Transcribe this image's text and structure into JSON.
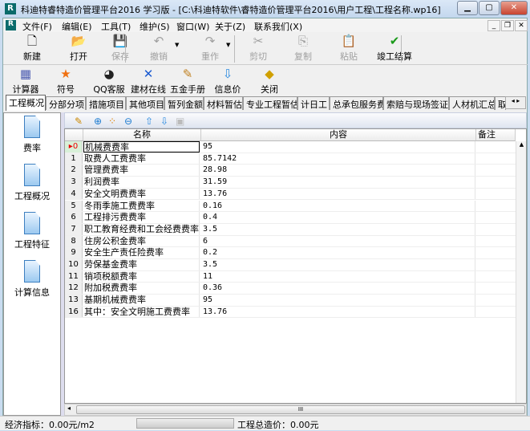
{
  "window": {
    "title": "科迪特睿特造价管理平台2016 学习版 - [C:\\科迪特软件\\睿特造价管理平台2016\\用户工程\\工程名称.wp16]",
    "logo": "R"
  },
  "menu": [
    "文件(F)",
    "编辑(E)",
    "工具(T)",
    "维护(S)",
    "窗口(W)",
    "关于(Z)",
    "联系我们(X)"
  ],
  "toolbar1": [
    {
      "label": "新建",
      "icon": "new-file-icon",
      "glyph": "🗋",
      "enabled": true
    },
    {
      "label": "打开",
      "icon": "open-folder-icon",
      "glyph": "📂",
      "enabled": true
    },
    {
      "label": "保存",
      "icon": "save-icon",
      "glyph": "💾",
      "enabled": false
    },
    {
      "label": "撤销",
      "icon": "undo-icon",
      "glyph": "↶",
      "enabled": false
    },
    {
      "label": "重作",
      "icon": "redo-icon",
      "glyph": "↷",
      "enabled": false
    },
    {
      "label": "剪切",
      "icon": "cut-icon",
      "glyph": "✂",
      "enabled": false
    },
    {
      "label": "复制",
      "icon": "copy-icon",
      "glyph": "⎘",
      "enabled": false
    },
    {
      "label": "粘贴",
      "icon": "paste-icon",
      "glyph": "📋",
      "enabled": false
    },
    {
      "label": "竣工结算",
      "icon": "checkmark-icon",
      "glyph": "✔",
      "enabled": true
    }
  ],
  "toolbar2": [
    {
      "label": "计算器",
      "icon": "calculator-icon",
      "glyph": "▦"
    },
    {
      "label": "符号",
      "icon": "star-icon",
      "glyph": "★"
    },
    {
      "label": "QQ客服",
      "icon": "qq-penguin-icon",
      "glyph": "◕"
    },
    {
      "label": "建材在线",
      "icon": "building-material-icon",
      "glyph": "✕"
    },
    {
      "label": "五金手册",
      "icon": "handbook-icon",
      "glyph": "✎"
    },
    {
      "label": "信息价",
      "icon": "down-arrow-icon",
      "glyph": "⇩"
    },
    {
      "label": "关闭",
      "icon": "close-sign-icon",
      "glyph": "◆"
    }
  ],
  "tabs": [
    "工程概况",
    "分部分项",
    "措施项目",
    "其他项目",
    "暂列金额",
    "材料暂估",
    "专业工程暂估",
    "计日工",
    "总承包服务费",
    "索赔与现场签证",
    "人材机汇总",
    "取费"
  ],
  "active_tab": "工程概况",
  "left_nav": [
    "费率",
    "工程概况",
    "工程特征",
    "计算信息"
  ],
  "grid": {
    "headers": [
      "名称",
      "内容",
      "备注"
    ],
    "rows": [
      {
        "no": "0",
        "name": "机械费费率",
        "value": "95"
      },
      {
        "no": "1",
        "name": "取费人工费费率",
        "value": "85.7142"
      },
      {
        "no": "2",
        "name": "管理费费率",
        "value": "28.98"
      },
      {
        "no": "3",
        "name": "利润费率",
        "value": "31.59"
      },
      {
        "no": "4",
        "name": "安全文明费费率",
        "value": "13.76"
      },
      {
        "no": "5",
        "name": "冬雨季施工费费率",
        "value": "0.16"
      },
      {
        "no": "6",
        "name": "工程排污费费率",
        "value": "0.4"
      },
      {
        "no": "7",
        "name": "职工教育经费和工会经费费率",
        "value": "3.5"
      },
      {
        "no": "8",
        "name": "住房公积金费率",
        "value": "6"
      },
      {
        "no": "9",
        "name": "安全生产责任险费率",
        "value": "0.2"
      },
      {
        "no": "10",
        "name": "劳保基金费率",
        "value": "3.5"
      },
      {
        "no": "11",
        "name": "销项税额费率",
        "value": "11"
      },
      {
        "no": "12",
        "name": "附加税费费率",
        "value": "0.36"
      },
      {
        "no": "13",
        "name": "基期机械费费率",
        "value": "95"
      },
      {
        "no": "16",
        "name": "其中：安全文明施工费费率",
        "value": "13.76"
      }
    ]
  },
  "status": {
    "economic_index": "经济指标：0.00元/m2",
    "total_cost": "工程总造价：0.00元"
  }
}
